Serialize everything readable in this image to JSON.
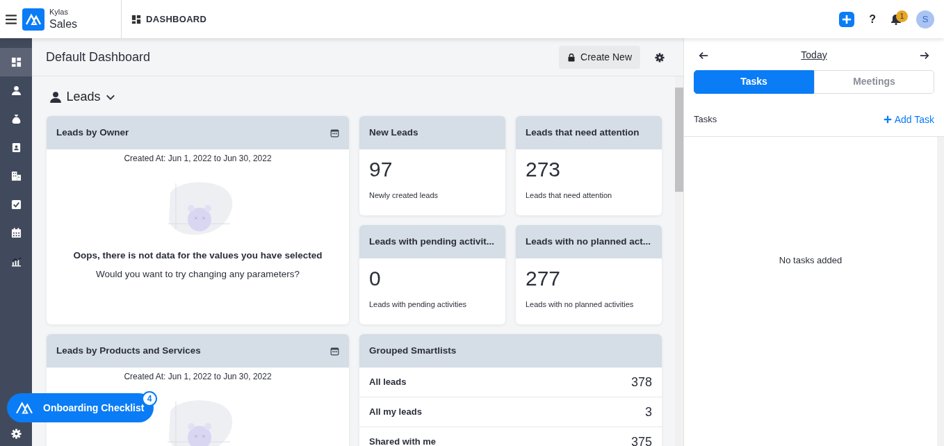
{
  "header": {
    "brand": "Kylas",
    "product": "Sales",
    "section": "DASHBOARD",
    "help_label": "?",
    "notification_count": "1",
    "avatar_initial": "S"
  },
  "sidebar": {
    "items": [
      {
        "kind": "dashboard",
        "selected": true
      },
      {
        "kind": "person",
        "selected": false
      },
      {
        "kind": "money-bag",
        "selected": false
      },
      {
        "kind": "contact-card",
        "selected": false
      },
      {
        "kind": "building",
        "selected": false
      },
      {
        "kind": "checkbox",
        "selected": false
      },
      {
        "kind": "calendar",
        "selected": false
      },
      {
        "kind": "chart",
        "selected": false
      }
    ]
  },
  "dashboard": {
    "title": "Default Dashboard",
    "create_button": "Create New",
    "entity": "Leads",
    "widgets": [
      {
        "kind": "empty_chart",
        "title": "Leads by Owner",
        "filter": "Created At: Jun 1, 2022 to Jun 30, 2022",
        "message": "Oops, there is not data for the values you have selected",
        "hint": "Would you want to try changing any parameters?"
      },
      {
        "kind": "metric",
        "title": "New Leads",
        "value": "97",
        "caption": "Newly created leads"
      },
      {
        "kind": "metric",
        "title": "Leads that need attention",
        "value": "273",
        "caption": "Leads that need attention"
      },
      {
        "kind": "metric",
        "title": "Leads with pending activit...",
        "value": "0",
        "caption": "Leads with pending activities"
      },
      {
        "kind": "metric",
        "title": "Leads with no planned act...",
        "value": "277",
        "caption": "Leads with no planned activities"
      },
      {
        "kind": "empty_chart",
        "title": "Leads by Products and Services",
        "filter": "Created At: Jun 1, 2022 to Jun 30, 2022"
      },
      {
        "kind": "list",
        "title": "Grouped Smartlists",
        "rows": [
          {
            "label": "All leads",
            "value": "378"
          },
          {
            "label": "All my leads",
            "value": "3"
          },
          {
            "label": "Shared with me",
            "value": "375"
          }
        ]
      }
    ]
  },
  "tasks_panel": {
    "date_label": "Today",
    "tabs": [
      {
        "label": "Tasks",
        "selected": true
      },
      {
        "label": "Meetings",
        "selected": false
      }
    ],
    "section": "Tasks",
    "add_button": "Add Task",
    "empty_message": "No tasks added"
  },
  "onboarding": {
    "label": "Onboarding Checklist",
    "count": "4"
  }
}
